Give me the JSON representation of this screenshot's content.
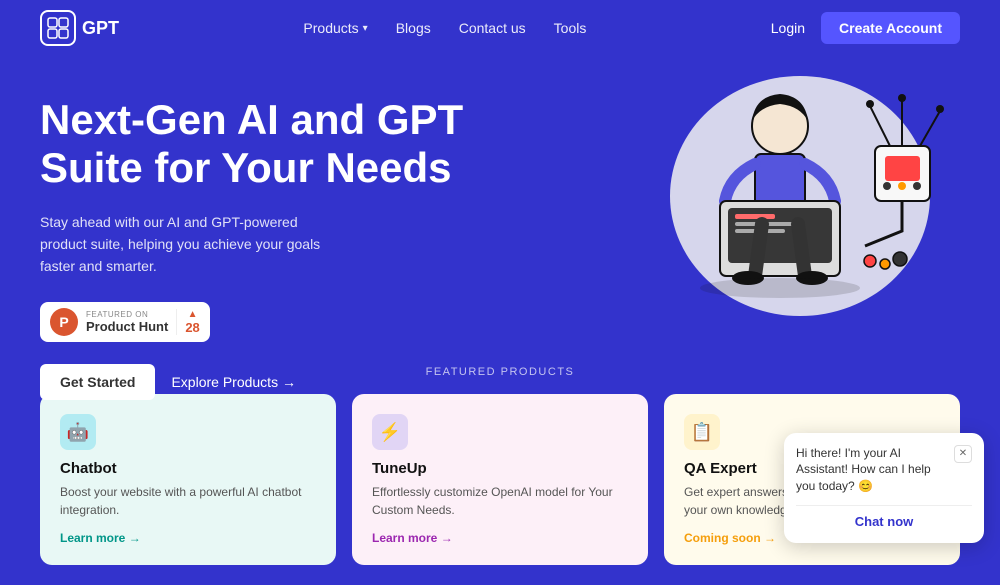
{
  "brand": {
    "logo_text": "GPT",
    "logo_icon": "🤖"
  },
  "navbar": {
    "products_label": "Products",
    "blogs_label": "Blogs",
    "contact_label": "Contact us",
    "tools_label": "Tools",
    "login_label": "Login",
    "create_account_label": "Create Account"
  },
  "hero": {
    "title": "Next-Gen AI and GPT Suite for Your Needs",
    "subtitle": "Stay ahead with our AI and GPT-powered product suite, helping you achieve your goals faster and smarter.",
    "product_hunt": {
      "featured_text": "FEATURED ON",
      "name": "Product Hunt",
      "vote_count": "28"
    },
    "get_started_label": "Get Started",
    "explore_label": "Explore Products →"
  },
  "featured": {
    "section_label": "FEATURED PRODUCTS",
    "products": [
      {
        "title": "Chatbot",
        "description": "Boost your website with a powerful AI chatbot integration.",
        "link_text": "Learn more →",
        "icon": "🤖"
      },
      {
        "title": "TuneUp",
        "description": "Effortlessly customize OpenAI model for Your Custom Needs.",
        "link_text": "Learn more →",
        "icon": "⚡"
      },
      {
        "title": "QA Expert",
        "description": "Get expert answers to all your questions from your own knowledgebase files.",
        "link_text": "Coming soon →",
        "icon": "📋"
      }
    ]
  },
  "chat_widget": {
    "message": "Hi there! I'm your AI Assistant! How can I help you today? 😊",
    "chat_now_label": "Chat now",
    "close_label": "✕"
  }
}
